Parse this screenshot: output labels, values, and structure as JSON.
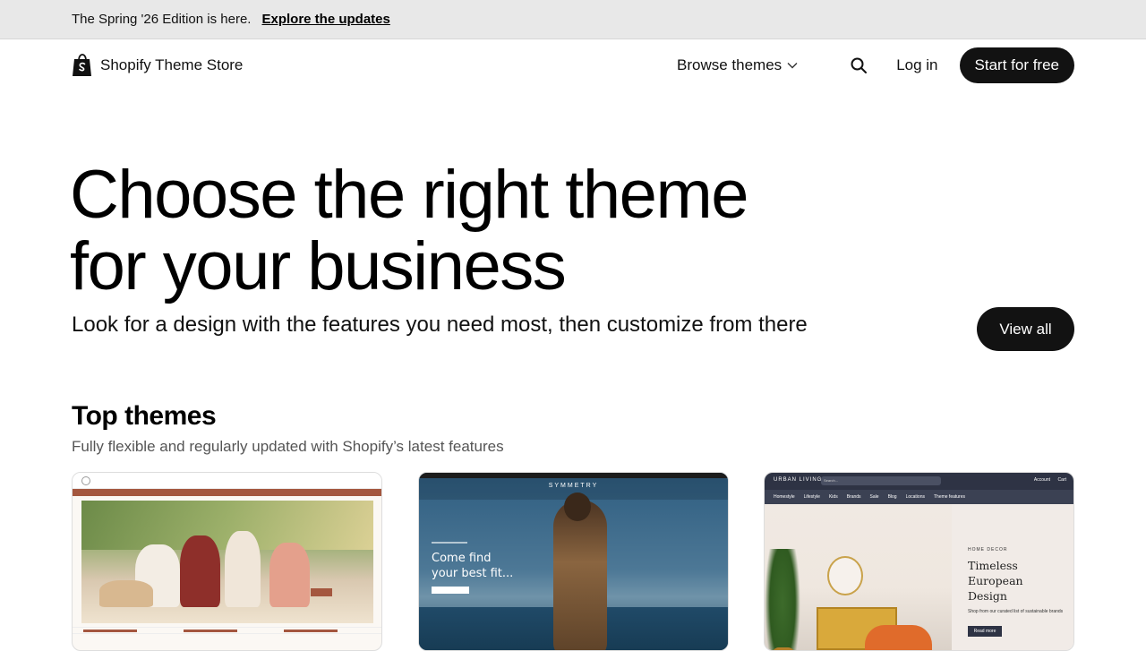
{
  "announcement": {
    "text": "The Spring '26 Edition is here.",
    "link": "Explore the updates"
  },
  "header": {
    "brand": "Shopify Theme Store",
    "browse": "Browse themes",
    "login": "Log in",
    "start": "Start for free"
  },
  "hero": {
    "title_line1": "Choose the right theme",
    "title_line2": "for your business",
    "subtitle": "Look for a design with the features you need most, then customize from there",
    "view_all": "View all"
  },
  "top_themes": {
    "title": "Top themes",
    "subtitle": "Fully flexible and regularly updated with Shopify’s latest features",
    "cards": [
      {
        "name": "shrine-preview"
      },
      {
        "name": "symmetry-preview",
        "brand": "SYMMETRY",
        "headline_1": "Come find",
        "headline_2": "your best fit..."
      },
      {
        "name": "urban-living-preview",
        "brand": "URBAN LIVING",
        "search": "Search...",
        "account": "Account",
        "cart": "Cart",
        "menu": [
          "Homestyle",
          "Lifestyle",
          "Kids",
          "Brands",
          "Sale",
          "Blog",
          "Locations",
          "Theme features"
        ],
        "kicker": "HOME DECOR",
        "headline": [
          "Timeless",
          "European",
          "Design"
        ],
        "desc": "Shop from our curated list of sustainable brands",
        "button": "Read more"
      }
    ]
  },
  "colors": {
    "announcement_bg": "#e8e8e8",
    "button_dark": "#121212",
    "brand_green": "#95bf47"
  }
}
